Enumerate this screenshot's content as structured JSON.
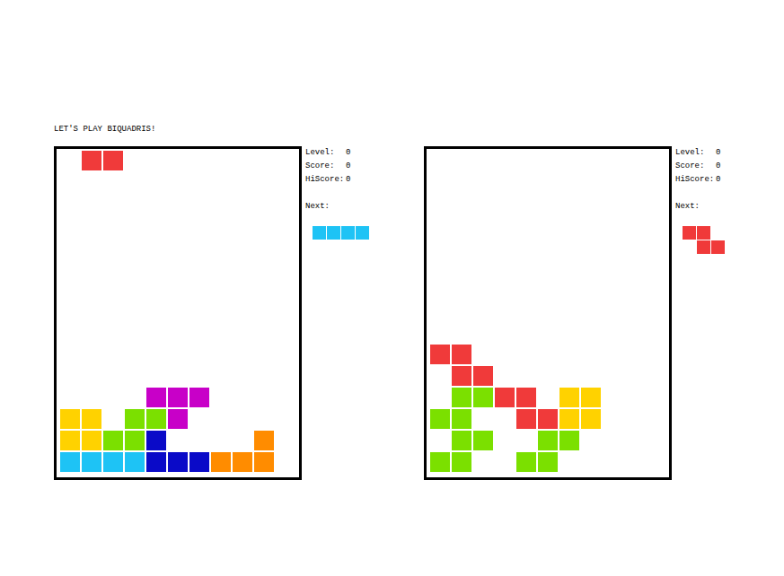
{
  "title": "LET'S PLAY BIQUADRIS!",
  "players": [
    {
      "stats": [
        {
          "label": "Level:",
          "value": "0"
        },
        {
          "label": "Score:",
          "value": "0"
        },
        {
          "label": "HiScore:",
          "value": "0"
        }
      ],
      "next_label": "Next:",
      "next": [
        {
          "row": 0,
          "col": 0,
          "color": "#1ec3f5"
        },
        {
          "row": 0,
          "col": 1,
          "color": "#1ec3f5"
        },
        {
          "row": 0,
          "col": 2,
          "color": "#1ec3f5"
        },
        {
          "row": 0,
          "col": 3,
          "color": "#1ec3f5"
        }
      ],
      "board": [
        {
          "row": 0,
          "col": 1,
          "color": "#f03a3a"
        },
        {
          "row": 0,
          "col": 2,
          "color": "#f03a3a"
        },
        {
          "row": 11,
          "col": 4,
          "color": "#c800c8"
        },
        {
          "row": 11,
          "col": 5,
          "color": "#c800c8"
        },
        {
          "row": 11,
          "col": 6,
          "color": "#c800c8"
        },
        {
          "row": 12,
          "col": 0,
          "color": "#ffd200"
        },
        {
          "row": 12,
          "col": 1,
          "color": "#ffd200"
        },
        {
          "row": 12,
          "col": 3,
          "color": "#7be000"
        },
        {
          "row": 12,
          "col": 4,
          "color": "#7be000"
        },
        {
          "row": 12,
          "col": 5,
          "color": "#c800c8"
        },
        {
          "row": 13,
          "col": 0,
          "color": "#ffd200"
        },
        {
          "row": 13,
          "col": 1,
          "color": "#ffd200"
        },
        {
          "row": 13,
          "col": 2,
          "color": "#7be000"
        },
        {
          "row": 13,
          "col": 3,
          "color": "#7be000"
        },
        {
          "row": 13,
          "col": 4,
          "color": "#0a0ac8"
        },
        {
          "row": 13,
          "col": 9,
          "color": "#ff8c00"
        },
        {
          "row": 14,
          "col": 0,
          "color": "#1ec3f5"
        },
        {
          "row": 14,
          "col": 1,
          "color": "#1ec3f5"
        },
        {
          "row": 14,
          "col": 2,
          "color": "#1ec3f5"
        },
        {
          "row": 14,
          "col": 3,
          "color": "#1ec3f5"
        },
        {
          "row": 14,
          "col": 4,
          "color": "#0a0ac8"
        },
        {
          "row": 14,
          "col": 5,
          "color": "#0a0ac8"
        },
        {
          "row": 14,
          "col": 6,
          "color": "#0a0ac8"
        },
        {
          "row": 14,
          "col": 7,
          "color": "#ff8c00"
        },
        {
          "row": 14,
          "col": 8,
          "color": "#ff8c00"
        },
        {
          "row": 14,
          "col": 9,
          "color": "#ff8c00"
        }
      ]
    },
    {
      "stats": [
        {
          "label": "Level:",
          "value": "0"
        },
        {
          "label": "Score:",
          "value": "0"
        },
        {
          "label": "HiScore:",
          "value": "0"
        }
      ],
      "next_label": "Next:",
      "next": [
        {
          "row": 0,
          "col": 0,
          "color": "#f03a3a"
        },
        {
          "row": 0,
          "col": 1,
          "color": "#f03a3a"
        },
        {
          "row": 1,
          "col": 1,
          "color": "#f03a3a"
        },
        {
          "row": 1,
          "col": 2,
          "color": "#f03a3a"
        }
      ],
      "board": [
        {
          "row": 9,
          "col": 0,
          "color": "#f03a3a"
        },
        {
          "row": 9,
          "col": 1,
          "color": "#f03a3a"
        },
        {
          "row": 10,
          "col": 1,
          "color": "#f03a3a"
        },
        {
          "row": 10,
          "col": 2,
          "color": "#f03a3a"
        },
        {
          "row": 11,
          "col": 1,
          "color": "#7be000"
        },
        {
          "row": 11,
          "col": 2,
          "color": "#7be000"
        },
        {
          "row": 11,
          "col": 3,
          "color": "#f03a3a"
        },
        {
          "row": 11,
          "col": 4,
          "color": "#f03a3a"
        },
        {
          "row": 11,
          "col": 6,
          "color": "#ffd200"
        },
        {
          "row": 11,
          "col": 7,
          "color": "#ffd200"
        },
        {
          "row": 12,
          "col": 0,
          "color": "#7be000"
        },
        {
          "row": 12,
          "col": 1,
          "color": "#7be000"
        },
        {
          "row": 12,
          "col": 4,
          "color": "#f03a3a"
        },
        {
          "row": 12,
          "col": 5,
          "color": "#f03a3a"
        },
        {
          "row": 12,
          "col": 6,
          "color": "#ffd200"
        },
        {
          "row": 12,
          "col": 7,
          "color": "#ffd200"
        },
        {
          "row": 13,
          "col": 1,
          "color": "#7be000"
        },
        {
          "row": 13,
          "col": 2,
          "color": "#7be000"
        },
        {
          "row": 13,
          "col": 5,
          "color": "#7be000"
        },
        {
          "row": 13,
          "col": 6,
          "color": "#7be000"
        },
        {
          "row": 14,
          "col": 0,
          "color": "#7be000"
        },
        {
          "row": 14,
          "col": 1,
          "color": "#7be000"
        },
        {
          "row": 14,
          "col": 4,
          "color": "#7be000"
        },
        {
          "row": 14,
          "col": 5,
          "color": "#7be000"
        }
      ]
    }
  ]
}
